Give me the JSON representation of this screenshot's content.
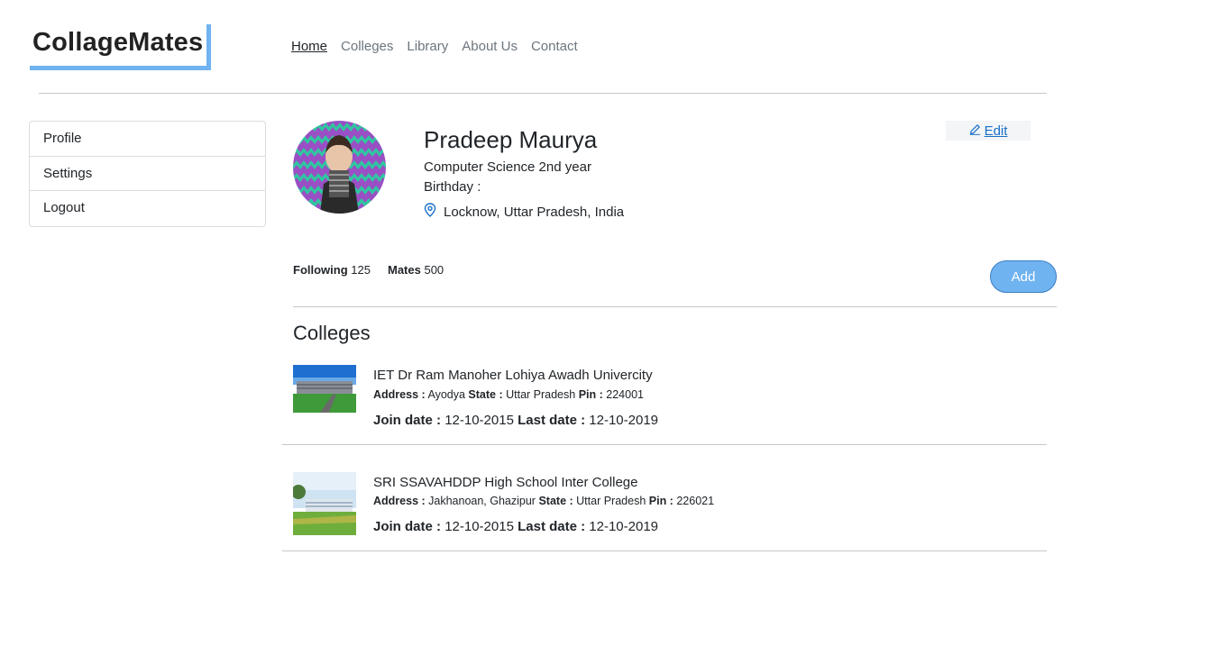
{
  "brand": {
    "logo": "CollageMates"
  },
  "nav": {
    "items": [
      "Home",
      "Colleges",
      "Library",
      "About Us",
      "Contact"
    ]
  },
  "sidebar": {
    "items": [
      "Profile",
      "Settings",
      "Logout"
    ]
  },
  "profile": {
    "name": "Pradeep Maurya",
    "course": "Computer Science 2nd year",
    "birthday_label": "Birthday :",
    "location": "Locknow, Uttar Pradesh, India",
    "edit_label": "Edit",
    "following_label": "Following",
    "following_count": "125",
    "mates_label": "Mates",
    "mates_count": "500",
    "add_label": "Add"
  },
  "colleges": {
    "title": "Colleges",
    "address_label": "Address :",
    "state_label": "State :",
    "pin_label": "Pin :",
    "join_label": "Join date :",
    "last_label": "Last date :",
    "items": [
      {
        "name": "IET Dr Ram Manoher Lohiya Awadh Univercity",
        "address": "Ayodya",
        "state": "Uttar Pradesh",
        "pin": "224001",
        "join_date": "12-10-2015",
        "last_date": "12-10-2019"
      },
      {
        "name": "SRI SSAVAHDDP High School Inter College",
        "address": "Jakhanoan, Ghazipur",
        "state": "Uttar Pradesh",
        "pin": "226021",
        "join_date": "12-10-2015",
        "last_date": "12-10-2019"
      }
    ]
  },
  "colors": {
    "accent": "#6fb3f0",
    "link": "#1a6fc9"
  },
  "icons": {
    "location": "map-pin-icon",
    "edit": "pencil-icon"
  }
}
